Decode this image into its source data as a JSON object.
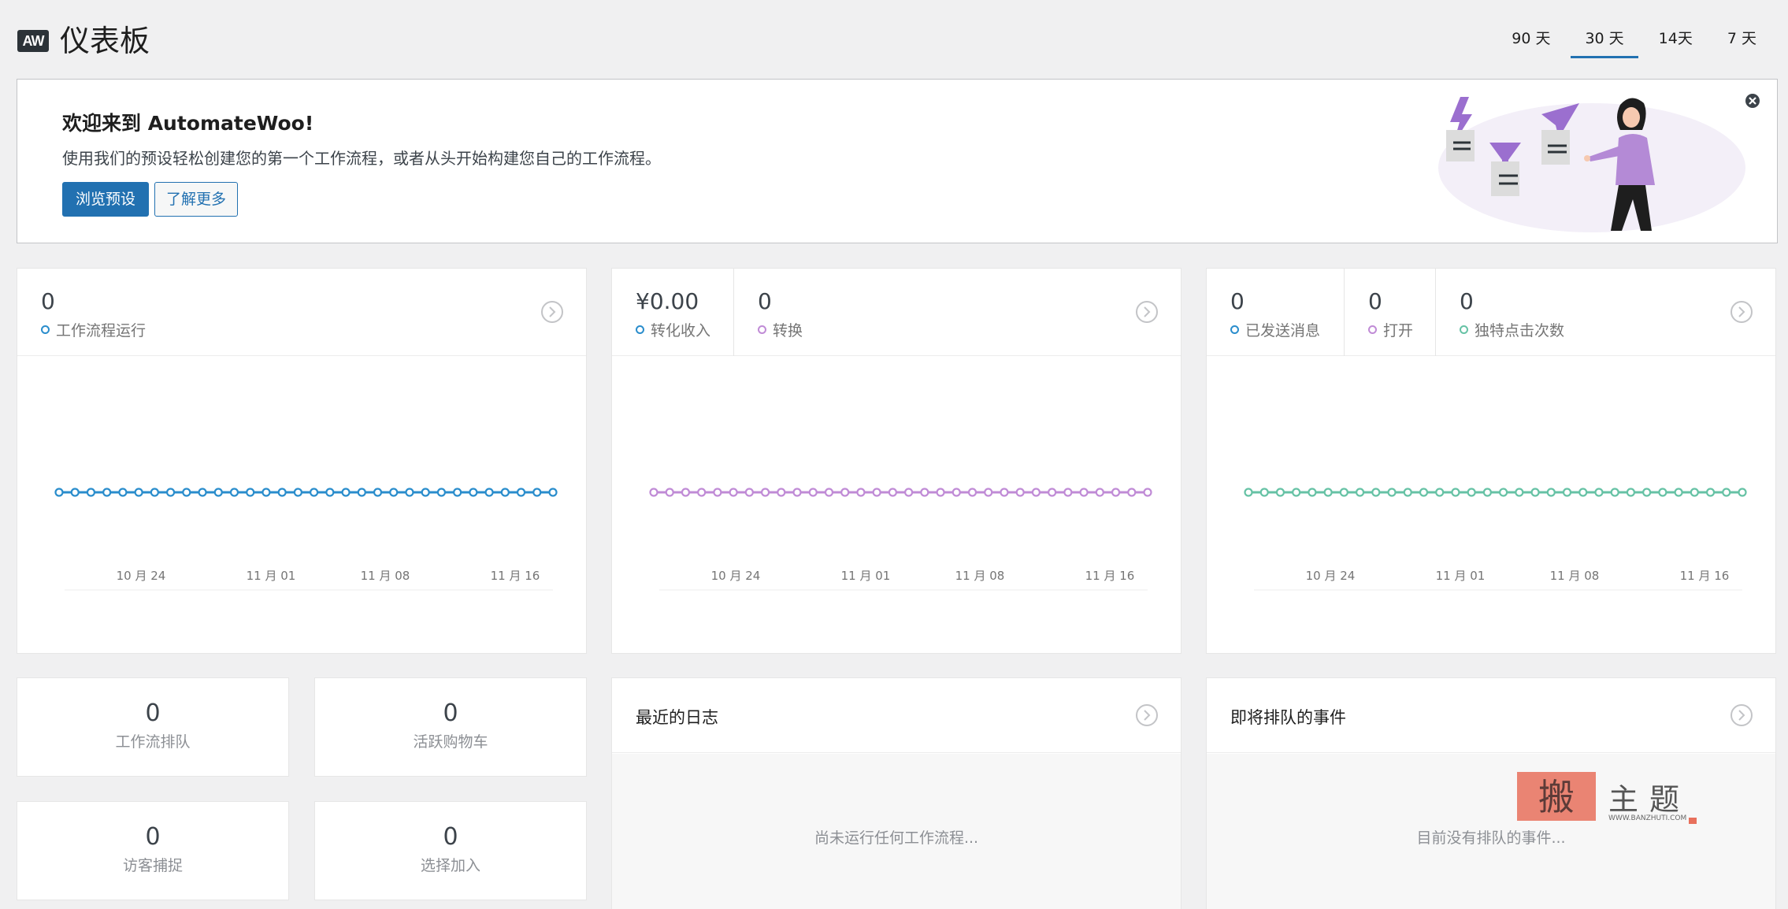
{
  "header": {
    "logo": "AW",
    "title": "仪表板",
    "range_tabs": [
      {
        "label": "90 天",
        "active": false
      },
      {
        "label": "30 天",
        "active": true
      },
      {
        "label": "14天",
        "active": false
      },
      {
        "label": "7 天",
        "active": false
      }
    ]
  },
  "welcome": {
    "title": "欢迎来到 AutomateWoo!",
    "description": "使用我们的预设轻松创建您的第一个工作流程，或者从头开始构建您自己的工作流程。",
    "primary_button": "浏览预设",
    "secondary_button": "了解更多"
  },
  "chart_cards": [
    {
      "metrics": [
        {
          "value": "0",
          "label": "工作流程运行",
          "color": "#2a8dcc"
        }
      ]
    },
    {
      "metrics": [
        {
          "value": "¥0.00",
          "label": "转化收入",
          "color": "#2a8dcc"
        },
        {
          "value": "0",
          "label": "转换",
          "color": "#c08bd6"
        }
      ]
    },
    {
      "metrics": [
        {
          "value": "0",
          "label": "已发送消息",
          "color": "#2a8dcc"
        },
        {
          "value": "0",
          "label": "打开",
          "color": "#c08bd6"
        },
        {
          "value": "0",
          "label": "独特点击次数",
          "color": "#66c2a5"
        }
      ]
    }
  ],
  "chart_data": [
    {
      "type": "line",
      "x_ticks": [
        "10 月 24",
        "11 月 01",
        "11 月 08",
        "11 月 16"
      ],
      "series": [
        {
          "name": "工作流程运行",
          "color": "#2a8dcc",
          "values": [
            0,
            0,
            0,
            0,
            0,
            0,
            0,
            0,
            0,
            0,
            0,
            0,
            0,
            0,
            0,
            0,
            0,
            0,
            0,
            0,
            0,
            0,
            0,
            0,
            0,
            0,
            0,
            0,
            0,
            0,
            0,
            0
          ]
        }
      ],
      "grid": false
    },
    {
      "type": "line",
      "x_ticks": [
        "10 月 24",
        "11 月 01",
        "11 月 08",
        "11 月 16"
      ],
      "series": [
        {
          "name": "转换",
          "color": "#c08bd6",
          "values": [
            0,
            0,
            0,
            0,
            0,
            0,
            0,
            0,
            0,
            0,
            0,
            0,
            0,
            0,
            0,
            0,
            0,
            0,
            0,
            0,
            0,
            0,
            0,
            0,
            0,
            0,
            0,
            0,
            0,
            0,
            0,
            0
          ]
        }
      ],
      "grid": false
    },
    {
      "type": "line",
      "x_ticks": [
        "10 月 24",
        "11 月 01",
        "11 月 08",
        "11 月 16"
      ],
      "series": [
        {
          "name": "独特点击次数",
          "color": "#66c2a5",
          "values": [
            0,
            0,
            0,
            0,
            0,
            0,
            0,
            0,
            0,
            0,
            0,
            0,
            0,
            0,
            0,
            0,
            0,
            0,
            0,
            0,
            0,
            0,
            0,
            0,
            0,
            0,
            0,
            0,
            0,
            0,
            0,
            0
          ]
        }
      ],
      "grid": false
    }
  ],
  "stats": [
    {
      "value": "0",
      "label": "工作流排队"
    },
    {
      "value": "0",
      "label": "活跃购物车"
    },
    {
      "value": "0",
      "label": "访客捕捉"
    },
    {
      "value": "0",
      "label": "选择加入"
    }
  ],
  "recent_logs": {
    "title": "最近的日志",
    "empty": "尚未运行任何工作流程..."
  },
  "queued_events": {
    "title": "即将排队的事件",
    "empty": "目前没有排队的事件..."
  },
  "watermark": {
    "text": "主题",
    "url": "WWW.BANZHUTI.COM"
  }
}
